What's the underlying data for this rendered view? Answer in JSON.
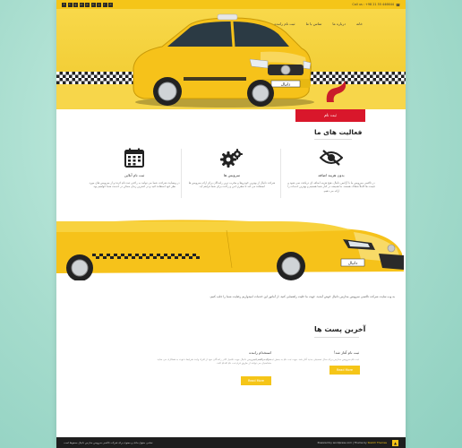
{
  "topbar": {
    "phone": "Call us : +98 21 55 446644",
    "socials": [
      "f",
      "t",
      "g",
      "in",
      "p",
      "v",
      "y",
      "r",
      "d"
    ]
  },
  "nav": {
    "items": [
      "خانه",
      "درباره ما",
      "تماس با ما",
      "ثبت نام راننده"
    ]
  },
  "hero": {
    "plate": "دانیال",
    "register_button": "ثبت نام"
  },
  "activities": {
    "title": "فعالیت های ما",
    "features": [
      {
        "icon": "eye-slash-icon",
        "title": "بدون هزینه اضافه",
        "desc": "در تاکسی سرویس ما با آژانس دانیال، هیچ هزینه اضافه ای دریافت نمی شود و قیمت ها کاملاً شفاف هستند. ما همیشه در کنار شما هستیم و بهترین خدمات را ارائه می دهیم."
      },
      {
        "icon": "gears-icon",
        "title": "سرویس ها",
        "desc": "شرکت دانیال از بهترین خودروها و مجرب ترین رانندگان برای ارائه سرویس ها استفاده می کند تا سفری امن و راحت برای شما فراهم آید."
      },
      {
        "icon": "calendar-icon",
        "title": "ثبت نام آنلاین",
        "desc": "در وبسایت شرکت، شما می توانید به راحتی ثبت نام کرده و از سرویس های مورد نظر خود استفاده کنید و در کمترین زمان ممکن در خدمت شما خواهیم بود."
      }
    ]
  },
  "intro": {
    "text": "به وب سایت شرکت تاکسی سرویس مدارس دانیال خوش آمدید. جهت ما خلیت راهنمایی کنید. از آماتور این خدمات امیدواریم رضایت شما را جلب کنیم."
  },
  "posts": {
    "title": "آخرین پست ها",
    "items": [
      {
        "title": "استخدام راننده",
        "meta": "شرکت تاکسی سرویس دانیال جهت تکمیل کادر رانندگان خود از افراد واجد شرایط دعوت به همکاری می نماید. متقاضیان می توانند از طریق فرم ثبت نام اقدام کنند.",
        "read_more": "Read More"
      },
      {
        "title": "ثبت نام آغاز شد!",
        "meta": "ثبت نام سرویس مدارس برای سال تحصیلی جدید آغاز شد. جهت ثبت نام به بخش ثبت نام مراجعه کنید.",
        "read_more": "Read More"
      }
    ]
  },
  "footer": {
    "rights": "تمامی حقوق مادی و معنوی برای شرکت تاکسی سرویس مدارس دانیال محفوظ است.",
    "credit_prefix": "Powered by wordpress.com | Theme by",
    "credit_name": "Sketch Themes",
    "to_top": "▲"
  },
  "colors": {
    "accent": "#f5c518",
    "register": "#d9172b",
    "footer": "#1e1e1e"
  }
}
